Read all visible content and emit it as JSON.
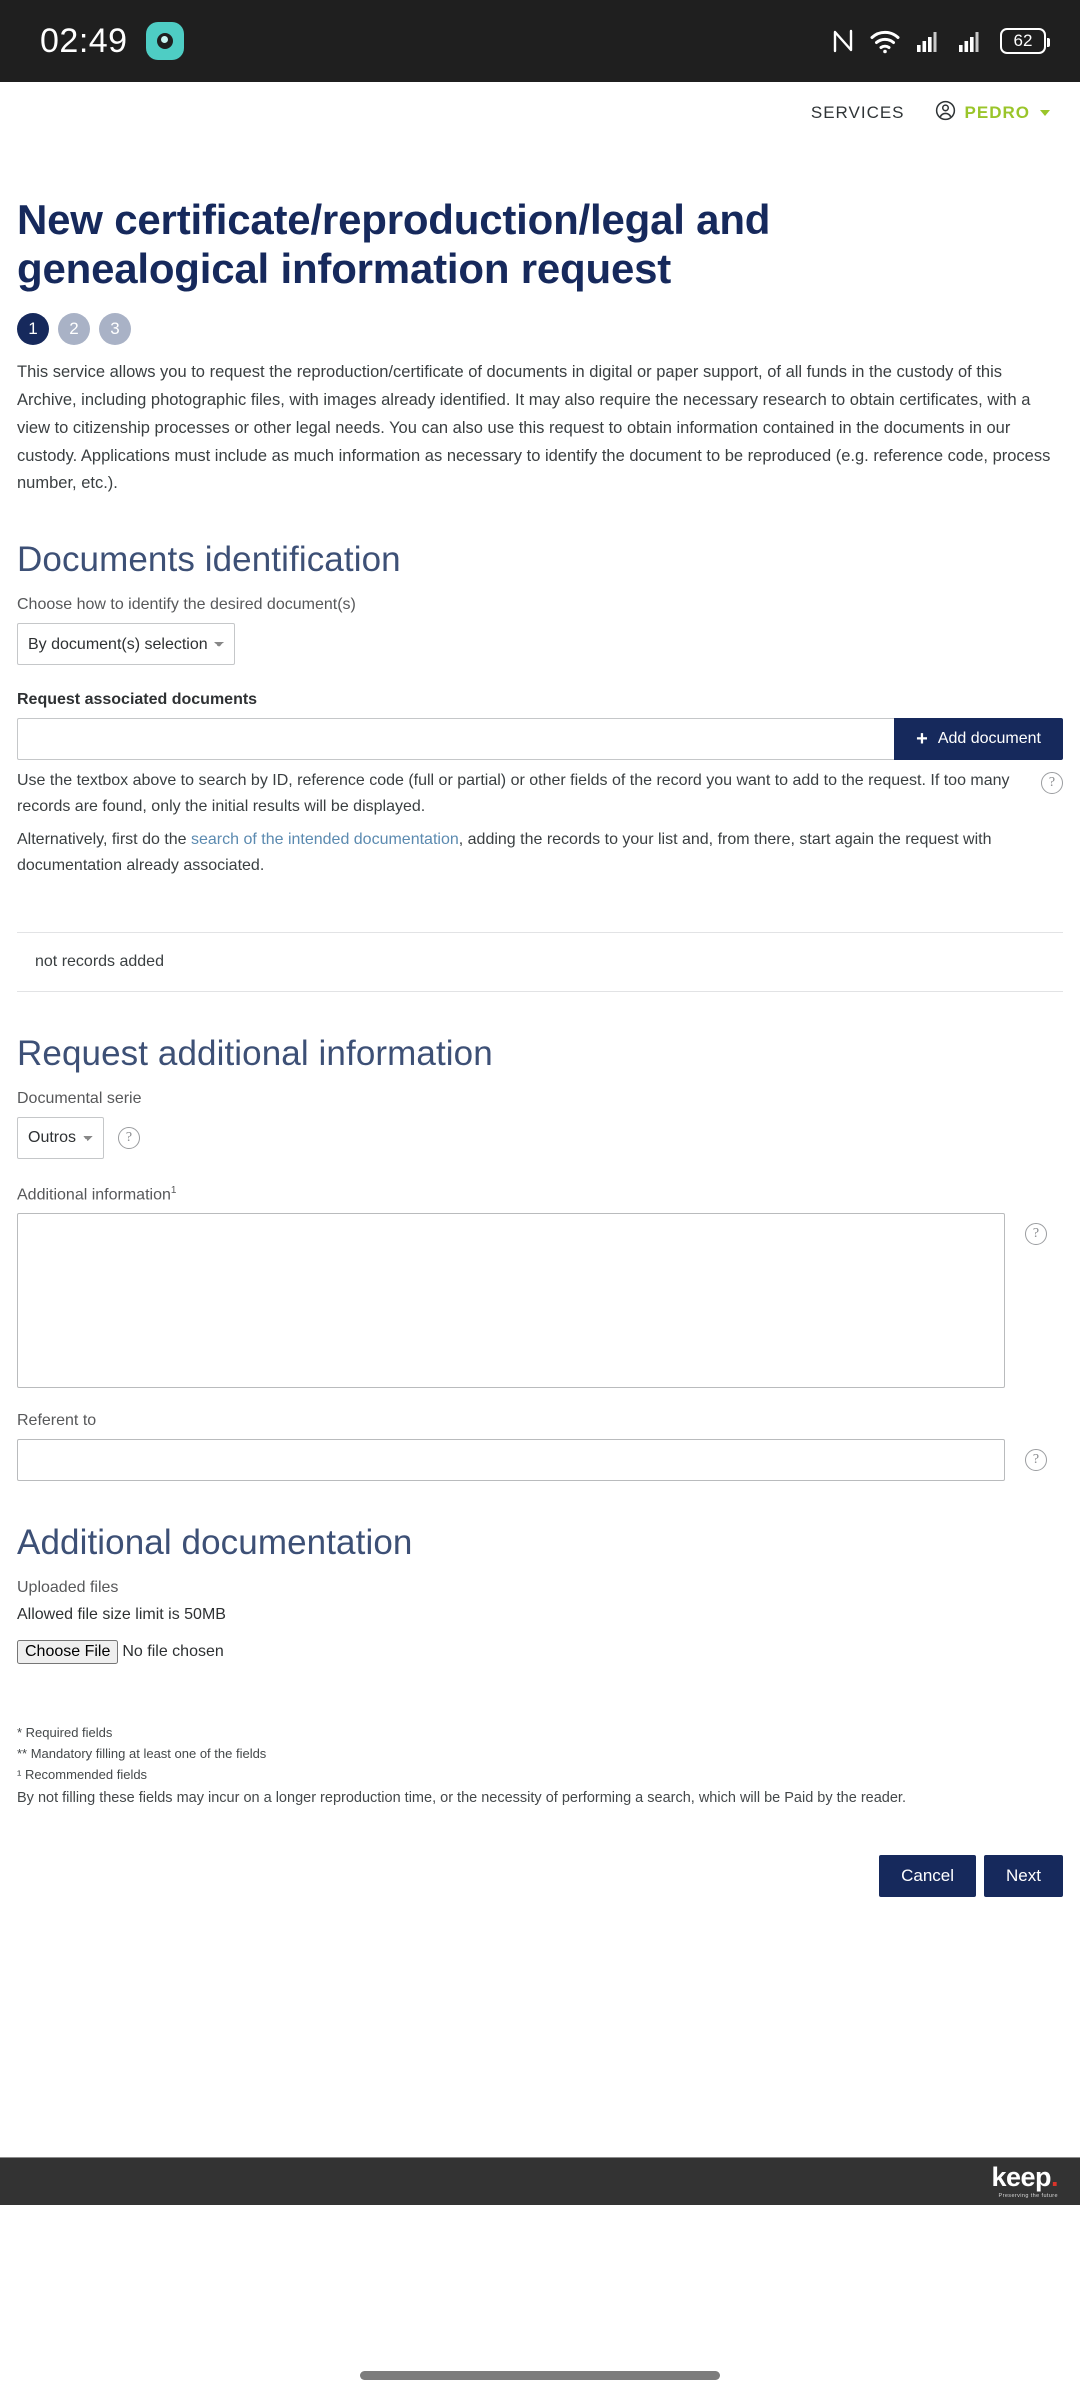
{
  "statusbar": {
    "time": "02:49",
    "app_icon": "camera-app-icon",
    "nfc_icon": "nfc-icon",
    "wifi_icon": "wifi-icon",
    "signal1_icon": "cellular-signal-icon",
    "signal2_icon": "cellular-signal-icon",
    "battery_level": "62"
  },
  "header": {
    "services_label": "SERVICES",
    "user_icon": "user-circle-icon",
    "user_name": "PEDRO",
    "caret_icon": "chevron-down-icon"
  },
  "main": {
    "title": "New certificate/reproduction/legal and genealogical information request",
    "steps": [
      {
        "label": "1",
        "state": "active"
      },
      {
        "label": "2",
        "state": "inactive"
      },
      {
        "label": "3",
        "state": "inactive"
      }
    ],
    "intro": "This service allows you to request the reproduction/certificate of documents in digital or paper support, of all funds in the custody of this Archive, including photographic files, with images already identified. It may also require the necessary research to obtain certificates, with a view to citizenship processes or other legal needs. You can also use this request to obtain information contained in the documents in our custody. Applications must include as much information as necessary to identify the document to be reproduced (e.g. reference code, process number, etc.)."
  },
  "documents_identification": {
    "heading": "Documents identification",
    "choose_label": "Choose how to identify the desired document(s)",
    "identify_select": {
      "value": "By document(s) selection",
      "options": [
        "By document(s) selection"
      ]
    },
    "associated_label": "Request associated documents",
    "search_input": {
      "value": "",
      "placeholder": ""
    },
    "add_button": "Add document",
    "add_button_icon": "plus-icon",
    "hint_line1": "Use the textbox above to search by ID, reference code (full or partial) or other fields of the record you want to add to the request. If too many records are found, only the initial results will be displayed.",
    "hint_line2_pre": "Alternatively, first do the ",
    "hint_link": "search of the intended documentation",
    "hint_line2_post": ", adding the records to your list and, from there, start again the request with documentation already associated.",
    "help_icon": "help-circle-icon",
    "no_records": "not records added"
  },
  "additional_information": {
    "heading": "Request additional information",
    "serie_label": "Documental serie",
    "serie_select": {
      "value": "Outros",
      "options": [
        "Outros"
      ]
    },
    "serie_help_icon": "help-circle-icon",
    "info_label": "Additional information",
    "info_label_sup": "1",
    "info_value": "",
    "info_help_icon": "help-circle-icon",
    "referent_label": "Referent to",
    "referent_value": "",
    "referent_help_icon": "help-circle-icon"
  },
  "additional_documentation": {
    "heading": "Additional documentation",
    "uploaded_label": "Uploaded files",
    "size_note": "Allowed file size limit is 50MB",
    "choose_file_button": "Choose File",
    "no_file_text": "No file chosen"
  },
  "footnotes": {
    "required": "* Required fields",
    "mandatory": "** Mandatory filling at least one of the fields",
    "recommended": "¹ Recommended fields",
    "note": "By not filling these fields may incur on a longer reproduction time, or the necessity of performing a search, which will be Paid by the reader."
  },
  "actions": {
    "cancel": "Cancel",
    "next": "Next"
  },
  "footer": {
    "logo_word": "keep",
    "logo_dot": ".",
    "tagline": "Preserving the future"
  },
  "colors": {
    "navy": "#16295c",
    "section_heading": "#3d5076",
    "accent_green": "#9ac52a",
    "link_blue": "#5b8ab0",
    "footer_bg": "#333333",
    "logo_red": "#d9342b",
    "step_inactive": "#a9b2c6"
  }
}
